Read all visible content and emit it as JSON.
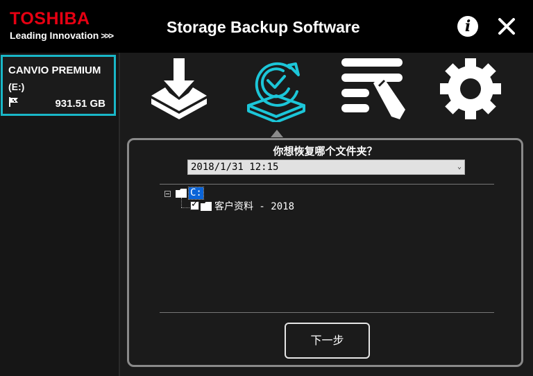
{
  "header": {
    "brand": "TOSHIBA",
    "tagline": "Leading Innovation",
    "tagline_chevrons": ">>>",
    "title": "Storage Backup Software",
    "info_label": "i",
    "close_icon": "close-icon"
  },
  "sidebar": {
    "drive": {
      "name": "CANVIO PREMIUM",
      "letter": "(E:)",
      "size": "931.51 GB",
      "icon": "flag-icon"
    }
  },
  "toolbar": {
    "items": [
      {
        "name": "backup",
        "icon": "download-tray-icon",
        "active": false
      },
      {
        "name": "restore",
        "icon": "restore-cycle-icon",
        "active": true
      },
      {
        "name": "log",
        "icon": "list-pencil-icon",
        "active": false
      },
      {
        "name": "settings",
        "icon": "gear-icon",
        "active": false
      }
    ]
  },
  "panel": {
    "question": "你想恢复哪个文件夹？",
    "selected_backup": "2018/1/31 12:15",
    "tree": {
      "root_label": "C:",
      "child_label": "客户资料 - 2018",
      "child_checked": true
    },
    "next_label": "下一步"
  },
  "colors": {
    "brand_red": "#e60012",
    "accent_cyan": "#19b7c8",
    "selection_blue": "#0a64d8",
    "background": "#1b1b1b"
  }
}
